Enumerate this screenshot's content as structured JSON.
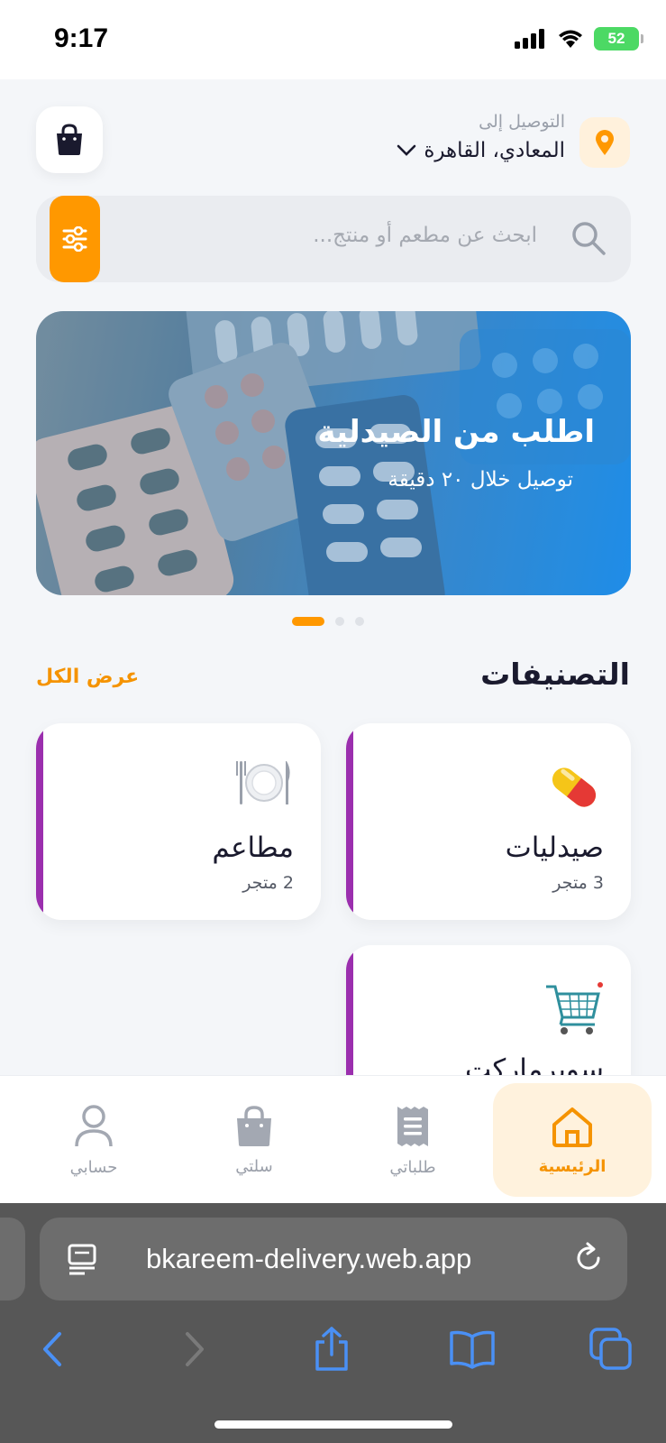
{
  "status_bar": {
    "time": "9:17",
    "battery": "52"
  },
  "header": {
    "deliver_label": "التوصيل إلى",
    "deliver_value": "المعادي، القاهرة"
  },
  "search": {
    "placeholder": "ابحث عن مطعم أو منتج..."
  },
  "banner": {
    "title": "اطلب من الصيدلية",
    "subtitle": "توصيل خلال ٢٠ دقيقة",
    "slide_count": 3,
    "active_slide": 1
  },
  "categories": {
    "title": "التصنيفات",
    "see_all": "عرض الكل",
    "items": [
      {
        "name": "صيدليات",
        "count": "3 متجر",
        "icon": "pill-icon"
      },
      {
        "name": "مطاعم",
        "count": "2 متجر",
        "icon": "plate-cutlery-icon"
      },
      {
        "name": "سوبرماركت",
        "icon": "shopping-cart-icon"
      }
    ],
    "accent_color": "#9b2fae"
  },
  "bottom_nav": {
    "items": [
      {
        "label": "الرئيسية",
        "icon": "home-icon",
        "active": true
      },
      {
        "label": "طلباتي",
        "icon": "receipt-icon",
        "active": false
      },
      {
        "label": "سلتي",
        "icon": "bag-icon",
        "active": false
      },
      {
        "label": "حسابي",
        "icon": "user-icon",
        "active": false
      }
    ],
    "active_color": "#f59300"
  },
  "browser": {
    "url": "bkareem-delivery.web.app"
  },
  "colors": {
    "primary": "#ff9800",
    "background": "#f4f6f9"
  }
}
